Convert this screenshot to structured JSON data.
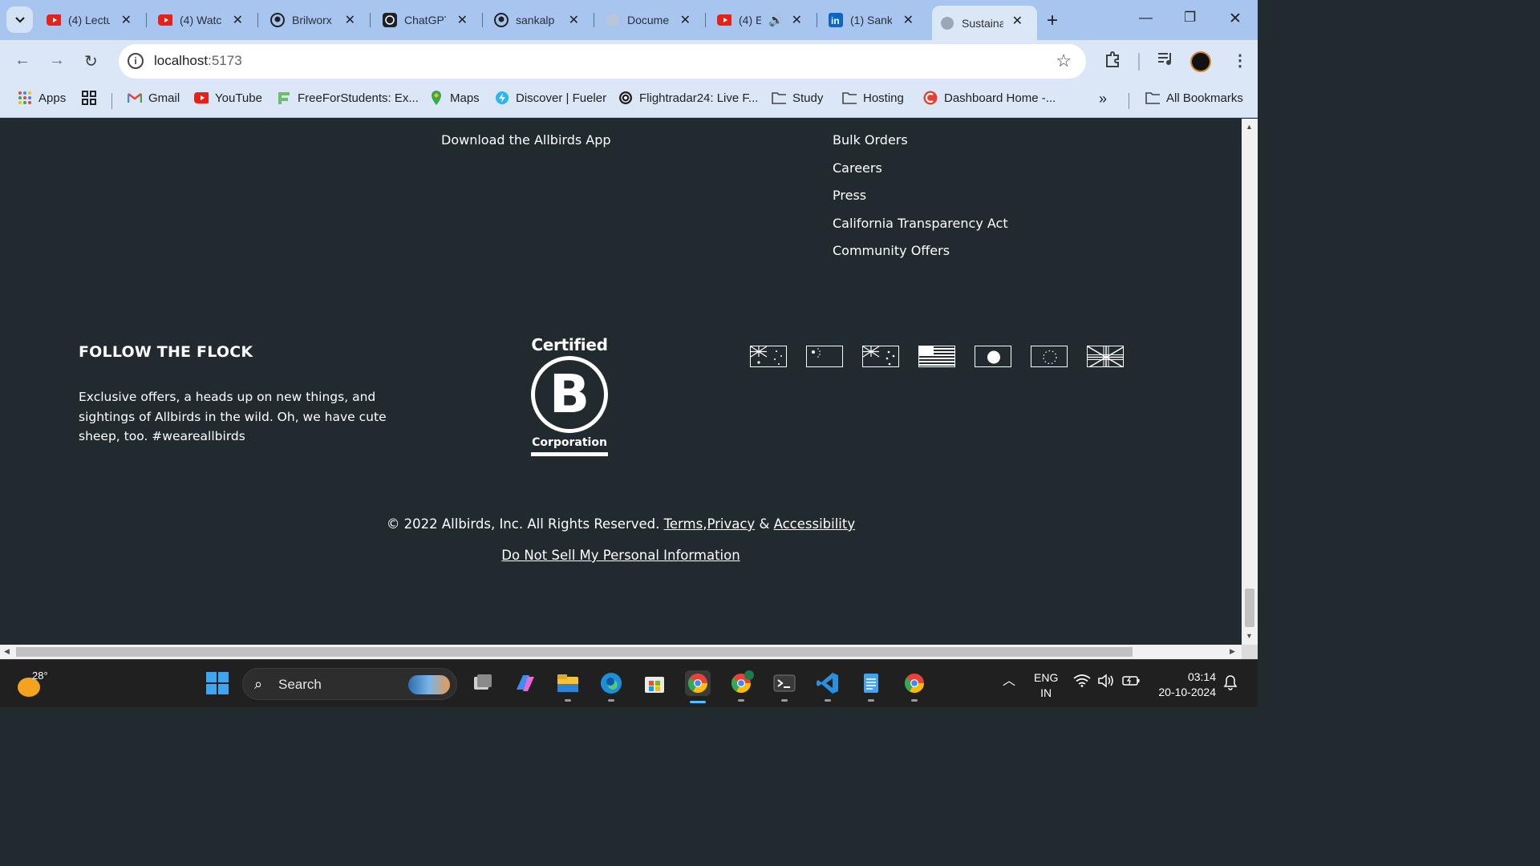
{
  "browser": {
    "tabs": [
      {
        "title": "(4) Lectu",
        "icon": "youtube-icon"
      },
      {
        "title": "(4) Watc",
        "icon": "youtube-icon"
      },
      {
        "title": "Brilworx",
        "icon": "github-icon"
      },
      {
        "title": "ChatGPT",
        "icon": "chatgpt-icon"
      },
      {
        "title": "sankalp",
        "icon": "github-icon"
      },
      {
        "title": "Docume",
        "icon": "globe-icon"
      },
      {
        "title": "(4) E",
        "icon": "youtube-icon"
      },
      {
        "title": "(1) Sank",
        "icon": "linkedin-icon"
      },
      {
        "title": "Sustaina",
        "icon": "globe-icon",
        "active": true
      }
    ],
    "url_host": "localhost",
    "url_port": ":5173",
    "bookmarks": [
      {
        "label": "Apps",
        "icon": "apps-grid-icon"
      },
      {
        "label": "",
        "icon": "tab-groups-icon"
      },
      {
        "label": "Gmail",
        "icon": "gmail-icon"
      },
      {
        "label": "YouTube",
        "icon": "youtube-icon"
      },
      {
        "label": "FreeForStudents: Ex...",
        "icon": "freeforstudents-icon"
      },
      {
        "label": "Maps",
        "icon": "maps-pin-icon"
      },
      {
        "label": "Discover | Fueler",
        "icon": "fueler-icon"
      },
      {
        "label": "Flightradar24: Live F...",
        "icon": "flightradar-icon"
      },
      {
        "label": "Study",
        "icon": "folder-icon"
      },
      {
        "label": "Hosting",
        "icon": "folder-icon"
      },
      {
        "label": "Dashboard Home -...",
        "icon": "dashboard-icon"
      }
    ],
    "overflow": "»",
    "all_bookmarks": "All Bookmarks"
  },
  "page": {
    "app_link": "Download the Allbirds App",
    "links": [
      "Bulk Orders",
      "Careers",
      "Press",
      "California Transparency Act",
      "Community Offers"
    ],
    "flock_title": "FOLLOW THE FLOCK",
    "flock_text": "Exclusive offers, a heads up on new things, and sightings of Allbirds in the wild. Oh, we have cute sheep, too. #weareallbirds",
    "bcorp": {
      "top": "Certified",
      "letter": "B",
      "bottom": "Corporation"
    },
    "flags": [
      "australia-flag-icon",
      "china-flag-icon",
      "new-zealand-flag-icon",
      "united-states-flag-icon",
      "japan-flag-icon",
      "europe-flag-icon",
      "united-kingdom-flag-icon"
    ],
    "copyright": "© 2022 Allbirds, Inc. All Rights Reserved.",
    "terms": "Terms",
    "comma": ",",
    "privacy": "Privacy",
    "amp": "&",
    "accessibility": "Accessibility",
    "do_not_sell": "Do Not Sell My Personal Information"
  },
  "taskbar": {
    "temperature": "28°",
    "search_label": "Search",
    "lang_line1": "ENG",
    "lang_line2": "IN",
    "time": "03:14",
    "date": "20-10-2024"
  }
}
